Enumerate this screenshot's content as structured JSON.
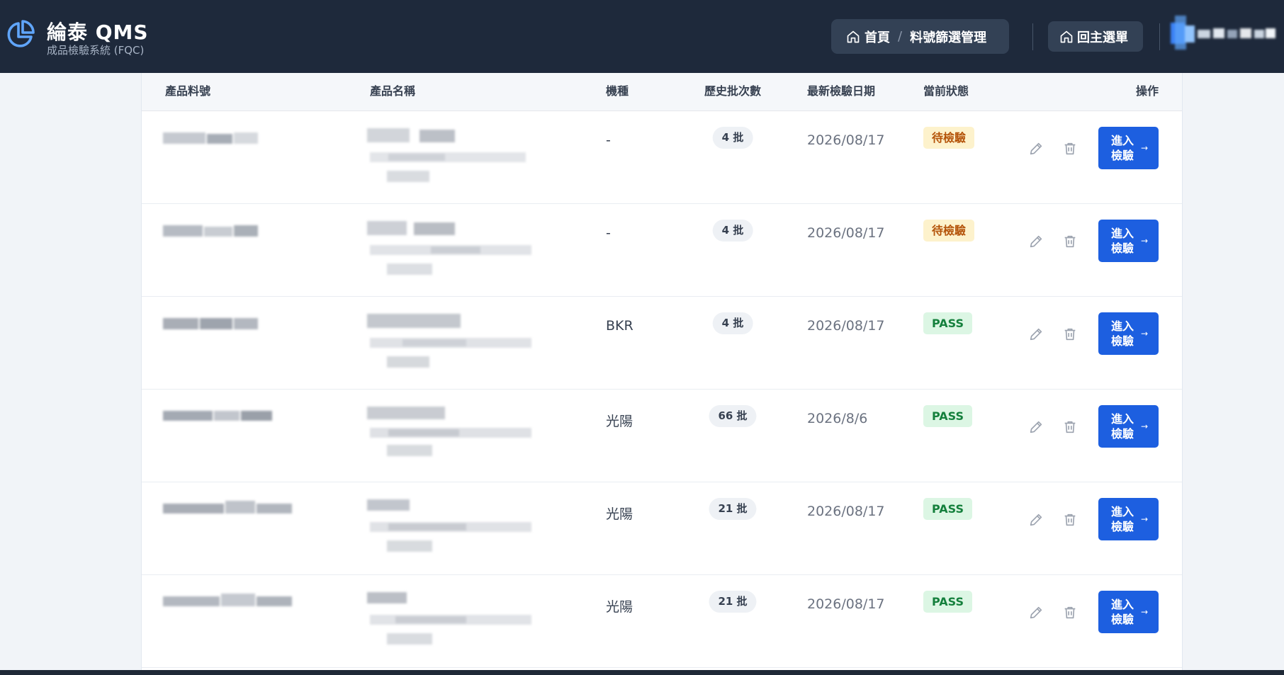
{
  "header": {
    "brand_title": "綸泰 QMS",
    "brand_subtitle": "成品檢驗系統 (FQC)",
    "breadcrumb": {
      "home_label": "首頁",
      "separator": "/",
      "current_label": "料號篩選管理"
    },
    "home_button_label": "回主選單"
  },
  "table": {
    "columns": {
      "part_no": "產品料號",
      "name": "產品名稱",
      "model": "機種",
      "batches": "歷史批次數",
      "last_date": "最新檢驗日期",
      "status": "當前狀態",
      "actions": "操作"
    },
    "enter_button_label": "進入\n檢驗",
    "enter_button_arrow": "→",
    "rows": [
      {
        "model": "-",
        "batches": "4 批",
        "last_date": "2026/08/17",
        "status": "待檢驗",
        "status_type": "pending"
      },
      {
        "model": "-",
        "batches": "4 批",
        "last_date": "2026/08/17",
        "status": "待檢驗",
        "status_type": "pending"
      },
      {
        "model": "BKR",
        "batches": "4 批",
        "last_date": "2026/08/17",
        "status": "PASS",
        "status_type": "pass"
      },
      {
        "model": "光陽",
        "batches": "66 批",
        "last_date": "2026/8/6",
        "status": "PASS",
        "status_type": "pass"
      },
      {
        "model": "光陽",
        "batches": "21 批",
        "last_date": "2026/08/17",
        "status": "PASS",
        "status_type": "pass"
      },
      {
        "model": "光陽",
        "batches": "21 批",
        "last_date": "2026/08/17",
        "status": "PASS",
        "status_type": "pass"
      }
    ]
  },
  "colors": {
    "header_bg": "#1e293b",
    "accent_blue": "#1d5fe0",
    "pending_bg": "#fdf2cc",
    "pending_text": "#b45309",
    "pass_bg": "#dcf6e4",
    "pass_text": "#15803d"
  },
  "icons": {
    "logo": "pie-chart-icon",
    "breadcrumb_home": "home-icon",
    "edit": "pencil-icon",
    "delete": "trash-icon"
  }
}
